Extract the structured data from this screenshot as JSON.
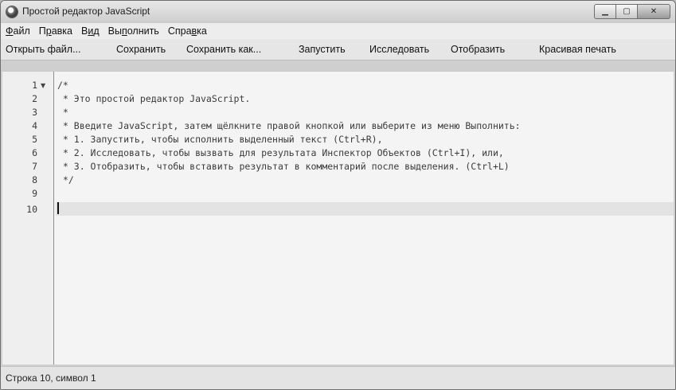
{
  "window": {
    "title": "Простой редактор JavaScript"
  },
  "menu": [
    {
      "pre": "",
      "ul": "Ф",
      "post": "айл"
    },
    {
      "pre": "П",
      "ul": "р",
      "post": "авка"
    },
    {
      "pre": "В",
      "ul": "и",
      "post": "д"
    },
    {
      "pre": "Вы",
      "ul": "п",
      "post": "олнить"
    },
    {
      "pre": "Спра",
      "ul": "в",
      "post": "ка"
    }
  ],
  "toolbar": {
    "open": "Открыть файл...",
    "save": "Сохранить",
    "save_as": "Сохранить как...",
    "run": "Запустить",
    "inspect": "Исследовать",
    "display": "Отобразить",
    "pretty_print": "Красивая печать"
  },
  "editor": {
    "line_numbers": [
      "1",
      "2",
      "3",
      "4",
      "5",
      "6",
      "7",
      "8",
      "9",
      "10"
    ],
    "lines": [
      "/*",
      " * Это простой редактор JavaScript.",
      " *",
      " * Введите JavaScript, затем щёлкните правой кнопкой или выберите из меню Выполнить:",
      " * 1. Запустить, чтобы исполнить выделенный текст (Ctrl+R),",
      " * 2. Исследовать, чтобы вызвать для результата Инспектор Объектов (Ctrl+I), или,",
      " * 3. Отобразить, чтобы вставить результат в комментарий после выделения. (Ctrl+L)",
      " */",
      "",
      ""
    ]
  },
  "status": {
    "text": "Строка 10, символ 1"
  }
}
